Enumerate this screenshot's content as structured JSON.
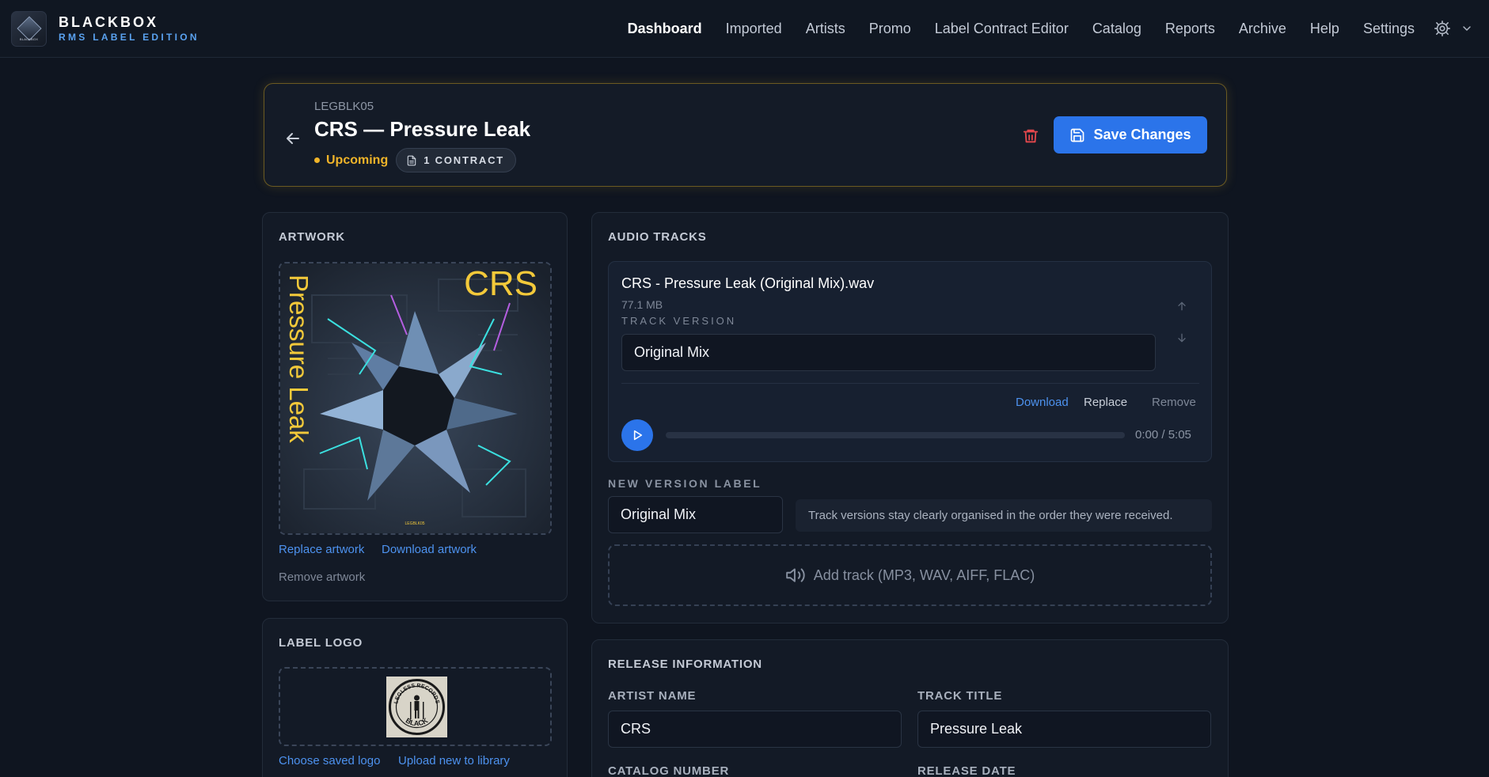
{
  "brand": {
    "logo_text": "BLACKBOX",
    "name": "BLACKBOX",
    "subtitle": "RMS LABEL EDITION"
  },
  "nav": {
    "items": [
      {
        "label": "Dashboard",
        "active": true
      },
      {
        "label": "Imported"
      },
      {
        "label": "Artists"
      },
      {
        "label": "Promo"
      },
      {
        "label": "Label Contract Editor"
      },
      {
        "label": "Catalog"
      },
      {
        "label": "Reports"
      },
      {
        "label": "Archive"
      },
      {
        "label": "Help"
      },
      {
        "label": "Settings"
      }
    ],
    "icons": [
      "gear-icon",
      "chevron-down-icon"
    ]
  },
  "header": {
    "code": "LEGBLK05",
    "title": "CRS — Pressure Leak",
    "status": "Upcoming",
    "contract_chip": "1 CONTRACT",
    "save_label": "Save Changes"
  },
  "artwork": {
    "title": "ARTWORK",
    "art_artist": "CRS",
    "art_title": "Pressure Leak",
    "art_code": "LEGBLK05",
    "replace": "Replace artwork",
    "download": "Download artwork",
    "remove": "Remove artwork"
  },
  "label_logo": {
    "title": "LABEL LOGO",
    "logo_text_top": "LEGLESS RECORDS",
    "logo_text_bottom": "BLACK",
    "choose": "Choose saved logo",
    "upload": "Upload new to library"
  },
  "audio": {
    "title": "AUDIO TRACKS",
    "track": {
      "filename": "CRS - Pressure Leak (Original Mix).wav",
      "size": "77.1 MB",
      "version_label": "TRACK VERSION",
      "version_value": "Original Mix",
      "download": "Download",
      "replace": "Replace",
      "remove": "Remove",
      "progress": 0,
      "time": "0:00 / 5:05"
    },
    "new_version_label": "NEW VERSION LABEL",
    "new_version_value": "Original Mix",
    "hint": "Track versions stay clearly organised in the order they were received.",
    "add_track": "Add track (MP3, WAV, AIFF, FLAC)"
  },
  "release": {
    "title": "RELEASE INFORMATION",
    "artist_label": "ARTIST NAME",
    "artist_value": "CRS",
    "track_label": "TRACK TITLE",
    "track_value": "Pressure Leak",
    "catalog_label": "CATALOG NUMBER",
    "date_label": "RELEASE DATE"
  },
  "colors": {
    "accent": "#2b74ea",
    "status": "#f0b429",
    "danger": "#e5484d",
    "link": "#4d92ef"
  }
}
